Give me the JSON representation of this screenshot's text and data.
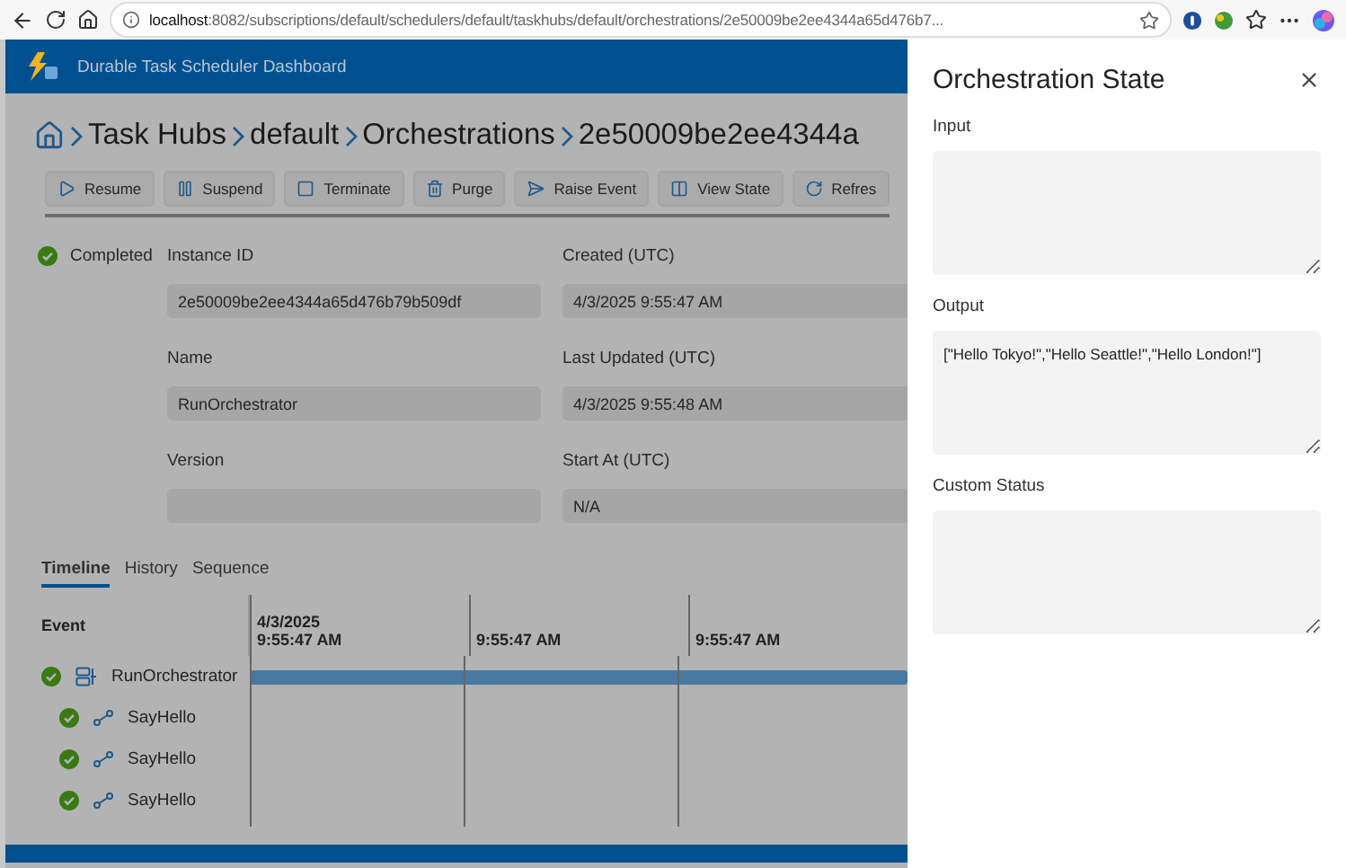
{
  "browser": {
    "url": "**localhost**:8082/subscriptions/default/schedulers/default/taskhubs/default/orchestrations/2e50009be2ee4344a65d476b7..."
  },
  "app": {
    "title": "Durable Task Scheduler Dashboard"
  },
  "breadcrumb": [
    "Task Hubs",
    "default",
    "Orchestrations",
    "2e50009be2ee4344a"
  ],
  "toolbar": [
    {
      "label": "Resume"
    },
    {
      "label": "Suspend"
    },
    {
      "label": "Terminate"
    },
    {
      "label": "Purge"
    },
    {
      "label": "Raise Event"
    },
    {
      "label": "View State"
    },
    {
      "label": "Refres"
    }
  ],
  "status": {
    "label": "Completed"
  },
  "fields": [
    {
      "label": "Instance ID",
      "value": "2e50009be2ee4344a65d476b79b509df"
    },
    {
      "label": "Created (UTC)",
      "value": "4/3/2025 9:55:47 AM"
    },
    {
      "label": "Name",
      "value": "RunOrchestrator"
    },
    {
      "label": "Last Updated (UTC)",
      "value": "4/3/2025 9:55:48 AM"
    },
    {
      "label": "Version"
    },
    {
      "label": "Start At (UTC)",
      "value": "N/A"
    }
  ],
  "tabs": [
    {
      "label": "Timeline",
      "selected": true
    },
    {
      "label": "History",
      "selected": false
    },
    {
      "label": "Sequence",
      "selected": false
    }
  ],
  "timeline": {
    "column_header": "Event",
    "ticks": [
      {
        "date": "4/3/2025",
        "time": "9:55:47 AM"
      },
      {
        "time": "9:55:47 AM"
      },
      {
        "time": "9:55:47 AM"
      }
    ],
    "rows": [
      {
        "name": "RunOrchestrator",
        "kind": "orchestrator",
        "children": [
          {
            "name": "SayHello",
            "kind": "activity"
          },
          {
            "name": "SayHello",
            "kind": "activity"
          },
          {
            "name": "SayHello",
            "kind": "activity"
          }
        ]
      }
    ]
  },
  "panel": {
    "title": "Orchestration State",
    "sections": [
      {
        "label": "Input"
      },
      {
        "label": "Output",
        "value": "[\"Hello Tokyo!\",\"Hello Seattle!\",\"Hello London!\"]"
      },
      {
        "label": "Custom Status"
      }
    ]
  }
}
